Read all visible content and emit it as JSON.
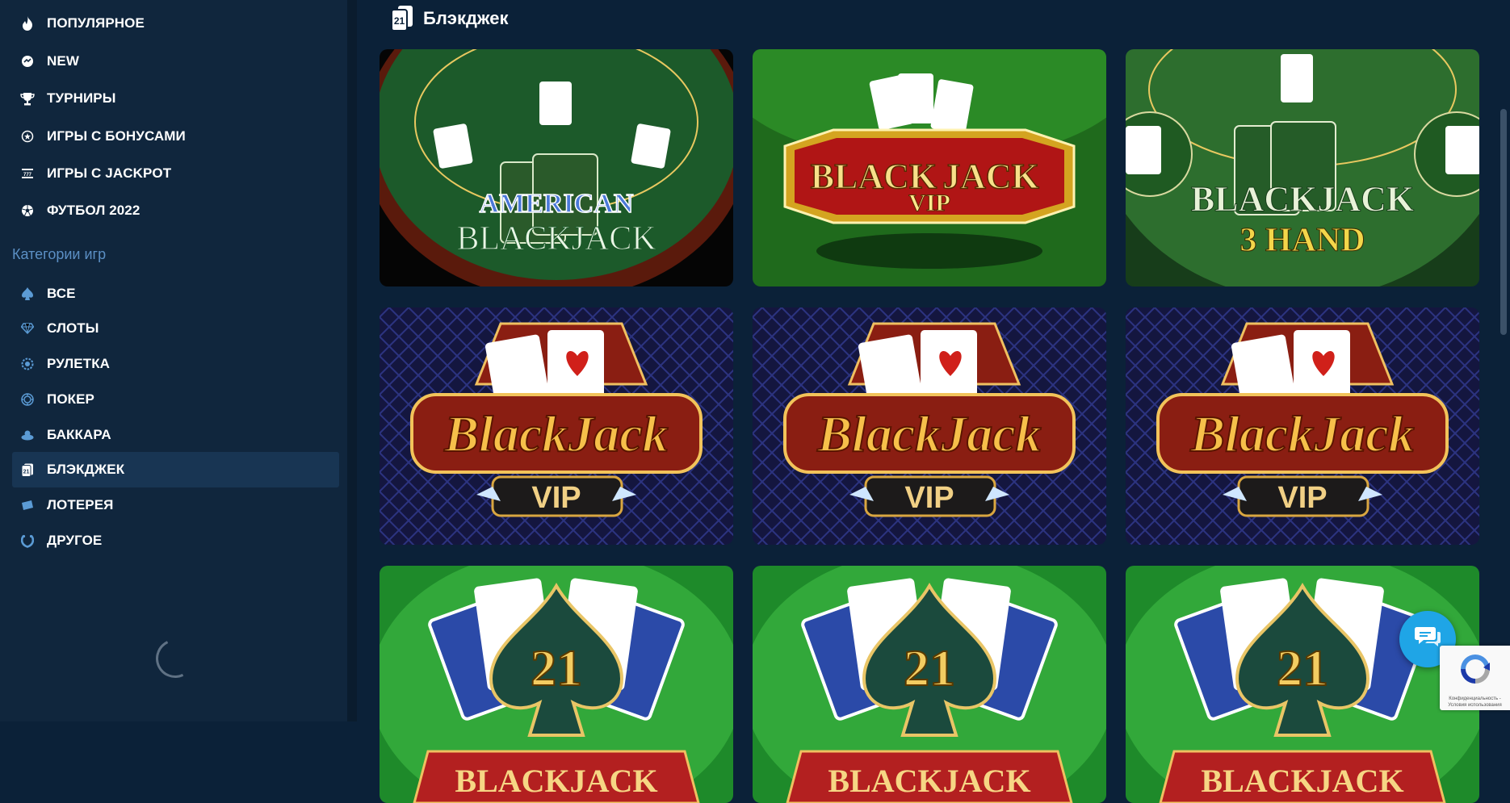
{
  "sidebar": {
    "main_items": [
      {
        "label": "ПОПУЛЯРНОЕ",
        "icon": "fire-icon"
      },
      {
        "label": "NEW",
        "icon": "new-badge-icon"
      },
      {
        "label": "ТУРНИРЫ",
        "icon": "trophy-icon"
      },
      {
        "label": "ИГРЫ С БОНУСАМИ",
        "icon": "bonus-icon"
      },
      {
        "label": "ИГРЫ С JACKPOT",
        "icon": "jackpot-icon"
      },
      {
        "label": "ФУТБОЛ 2022",
        "icon": "football-icon"
      }
    ],
    "categories_title": "Категории игр",
    "categories": [
      {
        "label": "ВСЕ",
        "icon": "spade-icon"
      },
      {
        "label": "СЛОТЫ",
        "icon": "diamond-icon"
      },
      {
        "label": "РУЛЕТКА",
        "icon": "roulette-icon"
      },
      {
        "label": "ПОКЕР",
        "icon": "poker-chip-icon"
      },
      {
        "label": "БАККАРА",
        "icon": "baccarat-icon"
      },
      {
        "label": "БЛЭКДЖЕК",
        "icon": "blackjack-icon",
        "active": true
      },
      {
        "label": "ЛОТЕРЕЯ",
        "icon": "ticket-icon"
      },
      {
        "label": "ДРУГОЕ",
        "icon": "horseshoe-icon"
      }
    ]
  },
  "main": {
    "title": "Блэкджек",
    "header_icon_text": "21",
    "games": [
      {
        "name": "American Blackjack",
        "line1": "AMERICAN",
        "line2": "BLACKJACK",
        "theme": "american"
      },
      {
        "name": "Blackjack VIP",
        "line1": "BLACK",
        "line2": "JACK",
        "line3": "VIP",
        "theme": "vip-green"
      },
      {
        "name": "Blackjack 3 Hand",
        "line1": "BLACKJACK",
        "line2": "3 HAND",
        "theme": "three-hand"
      },
      {
        "name": "BlackJack VIP",
        "line1": "BlackJack",
        "line2": "VIP",
        "theme": "vip-blue"
      },
      {
        "name": "BlackJack VIP",
        "line1": "BlackJack",
        "line2": "VIP",
        "theme": "vip-blue"
      },
      {
        "name": "BlackJack VIP",
        "line1": "BlackJack",
        "line2": "VIP",
        "theme": "vip-blue"
      },
      {
        "name": "21 Blackjack",
        "line1": "21",
        "line2": "BLACKJACK",
        "theme": "twentyone"
      },
      {
        "name": "21 Blackjack",
        "line1": "21",
        "line2": "BLACKJACK",
        "theme": "twentyone"
      },
      {
        "name": "21 Blackjack",
        "line1": "21",
        "line2": "BLACKJACK",
        "theme": "twentyone"
      }
    ]
  },
  "recaptcha": {
    "text": "Конфиденциальность - Условия использования"
  },
  "colors": {
    "background": "#0b2138",
    "sidebar": "#10263d",
    "active": "#183553",
    "accent": "#1fa5e6",
    "section_title": "#5b8fc4"
  }
}
